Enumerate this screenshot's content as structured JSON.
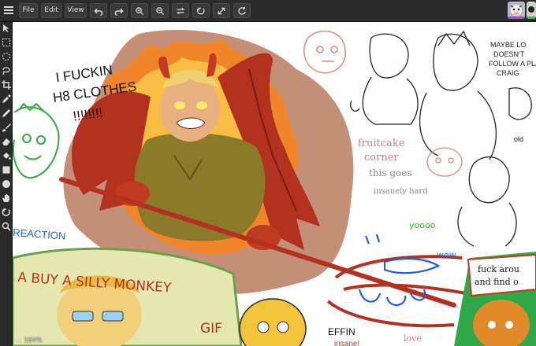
{
  "menu": {
    "file": "File",
    "edit": "Edit",
    "view": "View"
  },
  "icons": {
    "menu": "hamburger-icon",
    "toolbar": [
      "undo-icon",
      "redo-icon",
      "zoom-in-icon",
      "zoom-out-icon",
      "swap-icon",
      "reset-icon",
      "fullscreen-icon",
      "refresh-icon"
    ],
    "tools": [
      "pointer-icon",
      "select-rect-icon",
      "select-ellipse-icon",
      "lasso-icon",
      "crop-icon",
      "eyedropper-icon",
      "pen-icon",
      "brush-icon",
      "eraser-icon",
      "fill-bucket-icon",
      "rectangle-icon",
      "ellipse-icon",
      "hand-icon",
      "rotate-icon",
      "zoom-icon"
    ]
  },
  "status": {
    "zoom": "164%"
  },
  "canvas_text": {
    "shout": [
      "I FUCKIN",
      "H8 CLOTHES",
      "!!!!!!!!"
    ],
    "reaction": "REACTION",
    "banner": [
      "A BUY A SILLY MONKEY",
      "GIF"
    ],
    "fruitcake": [
      "fruitcake",
      "corner"
    ],
    "thisgoes": [
      "this goes",
      "insanely hard"
    ],
    "yoooo": "yoooo",
    "wow": "wow",
    "maybe": [
      "MAYBE LO",
      "DOESN'T",
      "FOLLOW A PLA",
      "CRAIG"
    ],
    "old": "old",
    "fuck": [
      "fuck arou",
      "and find o"
    ],
    "effin": [
      "EFFIN",
      "insane!"
    ],
    "love": "love"
  },
  "colors": {
    "fire": "#e8701a",
    "wings": "#b3321f",
    "shirt": "#8a7a2a",
    "blue": "#1f5fd6",
    "green": "#2faa3a"
  }
}
